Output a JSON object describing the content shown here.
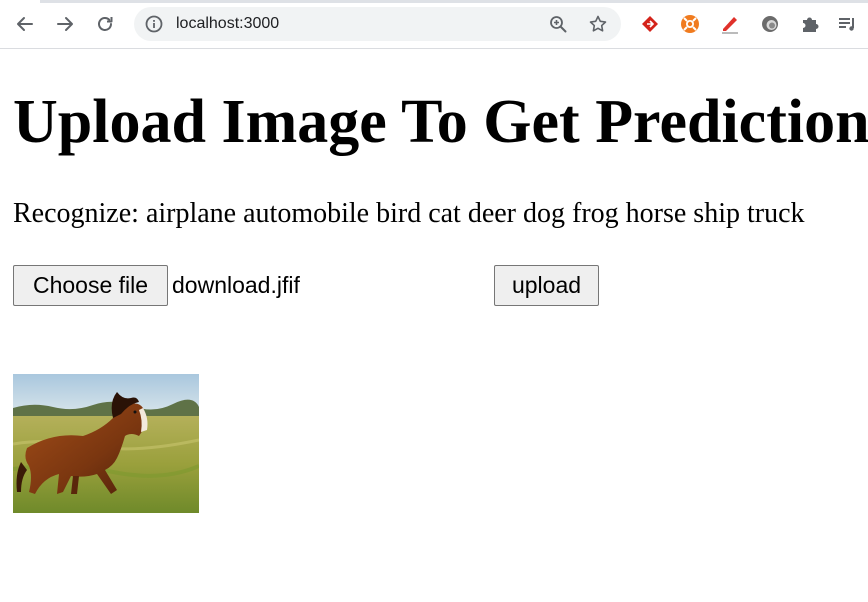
{
  "browser": {
    "url": "localhost:3000",
    "icons": {
      "back": "back-arrow-icon",
      "forward": "forward-arrow-icon",
      "reload": "reload-icon",
      "site_info": "info-icon",
      "zoom": "zoom-in-icon",
      "bookmark": "star-icon",
      "extensions": [
        "red-diamond-extension-icon",
        "orange-lifebuoy-extension-icon",
        "red-pen-extension-icon",
        "grey-circle-extension-icon",
        "puzzle-piece-icon",
        "reading-list-icon"
      ]
    }
  },
  "page": {
    "title": "Upload Image To Get Prediction",
    "recognize_text": "Recognize: airplane automobile bird cat deer dog frog horse ship truck",
    "file_input": {
      "button_label": "Choose file",
      "selected_file": "download.jfif"
    },
    "upload_label": "upload",
    "preview_image": "horse-photo"
  },
  "colors": {
    "toolbar_bg": "#ffffff",
    "omnibox_bg": "#f1f3f4",
    "button_bg": "#efefef",
    "button_border": "#767676"
  }
}
